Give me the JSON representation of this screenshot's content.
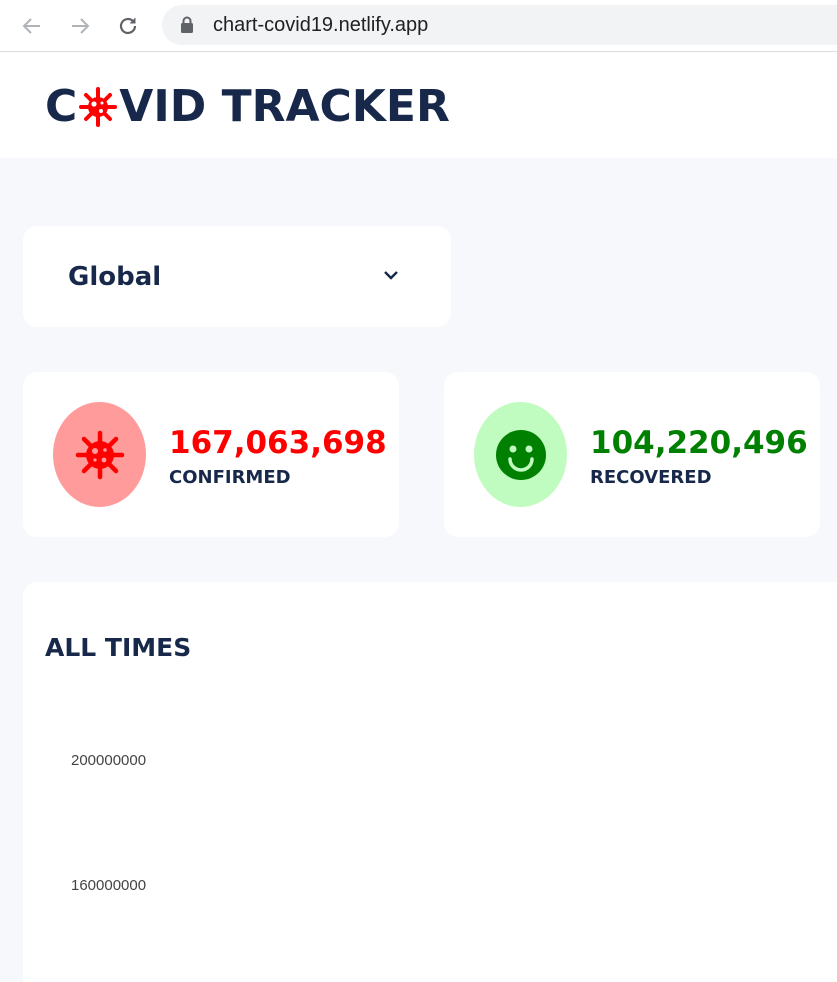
{
  "browser": {
    "url": "chart-covid19.netlify.app",
    "icons": [
      "back-arrow-icon",
      "forward-arrow-icon",
      "reload-icon",
      "lock-icon"
    ]
  },
  "header": {
    "logo_prefix": "C",
    "logo_suffix": "VID TRACKER",
    "logo_icon": "virus-icon",
    "colors": {
      "navy": "#17284a",
      "red": "#ff0000"
    }
  },
  "country_select": {
    "value": "Global",
    "icon": "chevron-down-icon"
  },
  "stats": {
    "confirmed": {
      "value": "167,063,698",
      "label": "CONFIRMED",
      "color": "#ff0000",
      "bg": "#ff9b9b",
      "icon": "virus-icon"
    },
    "recovered": {
      "value": "104,220,496",
      "label": "RECOVERED",
      "color": "#008000",
      "bg": "#c0fbc0",
      "icon": "smiley-icon"
    }
  },
  "chart": {
    "title": "ALL TIMES",
    "y_ticks": [
      "200000000",
      "160000000"
    ]
  }
}
